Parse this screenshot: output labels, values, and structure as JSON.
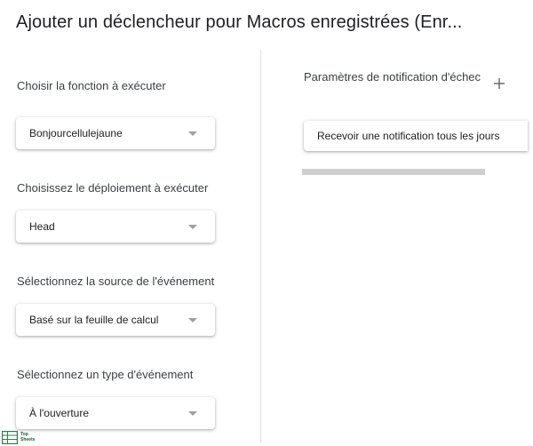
{
  "dialog": {
    "title": "Ajouter un déclencheur pour Macros enregistrées (Enr..."
  },
  "left": {
    "function": {
      "label": "Choisir la fonction à exécuter",
      "value": "Bonjourcellulejaune"
    },
    "deployment": {
      "label": "Choisissez le déploiement à exécuter",
      "value": "Head"
    },
    "event_source": {
      "label": "Sélectionnez la source de l'événement",
      "value": "Basé sur la feuille de calcul"
    },
    "event_type": {
      "label": "Sélectionnez un type d'événement",
      "value": "À l'ouverture"
    }
  },
  "right": {
    "failure_notification": {
      "title": "Paramètres de notification d'échec",
      "value": "Recevoir une notification tous les jours"
    }
  },
  "watermark": {
    "line1": "Top",
    "line2": "Sheets"
  },
  "colors": {
    "title_text": "#202124",
    "label_text": "#3c4043",
    "caret": "#9aa0a6",
    "divider": "#e0e0e0",
    "scrollbar": "#cfcfcf",
    "logo_green": "#1e5a3a"
  },
  "icons": {
    "dropdown": "caret-down-icon",
    "add": "plus-icon",
    "logo": "spreadsheet-logo-icon"
  }
}
